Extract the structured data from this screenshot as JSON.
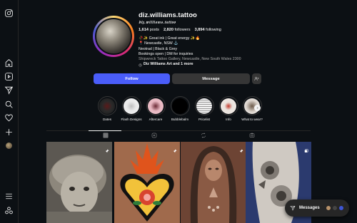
{
  "profile": {
    "username": "diz.williams.tattoo",
    "more": "···",
    "handle": "𝖉𝖎𝖟.𝖜𝖎𝖑𝖑𝖎𝖆𝖒𝖘.𝖙𝖆𝖙𝖙𝖔𝖔",
    "posts_count": "1,614",
    "posts_label": "posts",
    "followers_count": "2,820",
    "followers_label": "followers",
    "following_count": "3,894",
    "following_label": "following",
    "bio": [
      "🥀✨ Great ink | Great energy ✨🔥",
      "📍 Newcastle, NSW ⚓",
      "Neotrad | Black & Grey",
      "Bookings open | DM for inquiries"
    ],
    "address": "Shipwreck Tattoo Gallery, Newcastle, New South Wales 2300",
    "threads_link": "Diz Williams Art and 1 more"
  },
  "actions": {
    "follow_label": "Follow",
    "message_label": "Message"
  },
  "highlights": [
    {
      "label": "Dates",
      "color": "#2a2a2a"
    },
    {
      "label": "Flash Designs",
      "color": "#e8e8e8"
    },
    {
      "label": "Aftercare",
      "color": "#e7b6c0"
    },
    {
      "label": "Bubblebalm",
      "color": "#000000"
    },
    {
      "label": "Pricelist",
      "color": "#f0f0f0"
    },
    {
      "label": "Info",
      "color": "#e9e2dc"
    },
    {
      "label": "What to wear?",
      "color": "#ffffff"
    }
  ],
  "messages": {
    "label": "Messages"
  },
  "colors": {
    "background": "#0c1014",
    "follow_button": "#4a5df9",
    "secondary_button": "#363636"
  }
}
